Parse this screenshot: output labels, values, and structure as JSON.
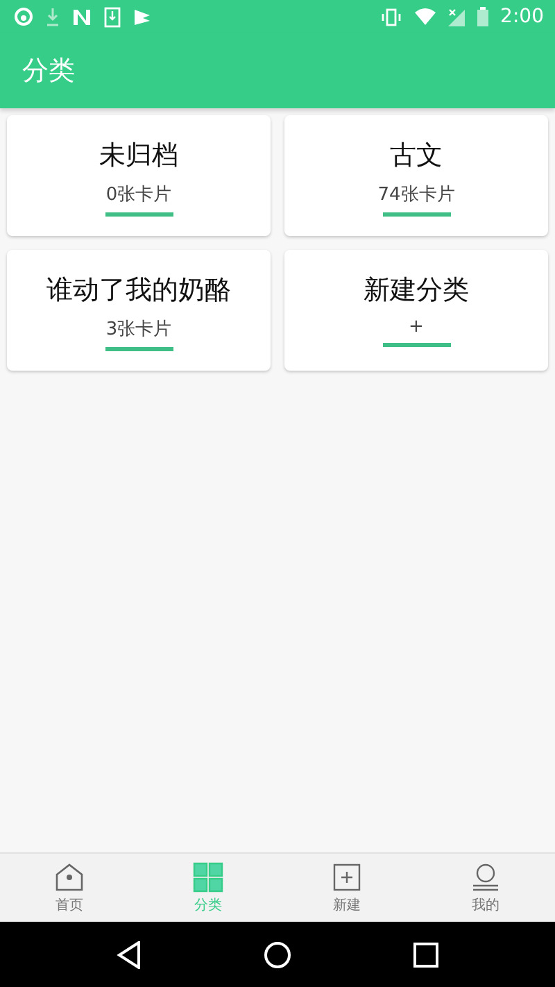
{
  "status_bar": {
    "time": "2:00"
  },
  "app_bar": {
    "title": "分类"
  },
  "categories": [
    {
      "title": "未归档",
      "subtitle": "0张卡片"
    },
    {
      "title": "古文",
      "subtitle": "74张卡片"
    },
    {
      "title": "谁动了我的奶酪",
      "subtitle": "3张卡片"
    },
    {
      "title": "新建分类",
      "subtitle": "+"
    }
  ],
  "bottom_nav": [
    {
      "kind": "home",
      "label": "首页",
      "selected": false
    },
    {
      "kind": "grid",
      "label": "分类",
      "selected": true
    },
    {
      "kind": "add",
      "label": "新建",
      "selected": false
    },
    {
      "kind": "user",
      "label": "我的",
      "selected": false
    }
  ]
}
